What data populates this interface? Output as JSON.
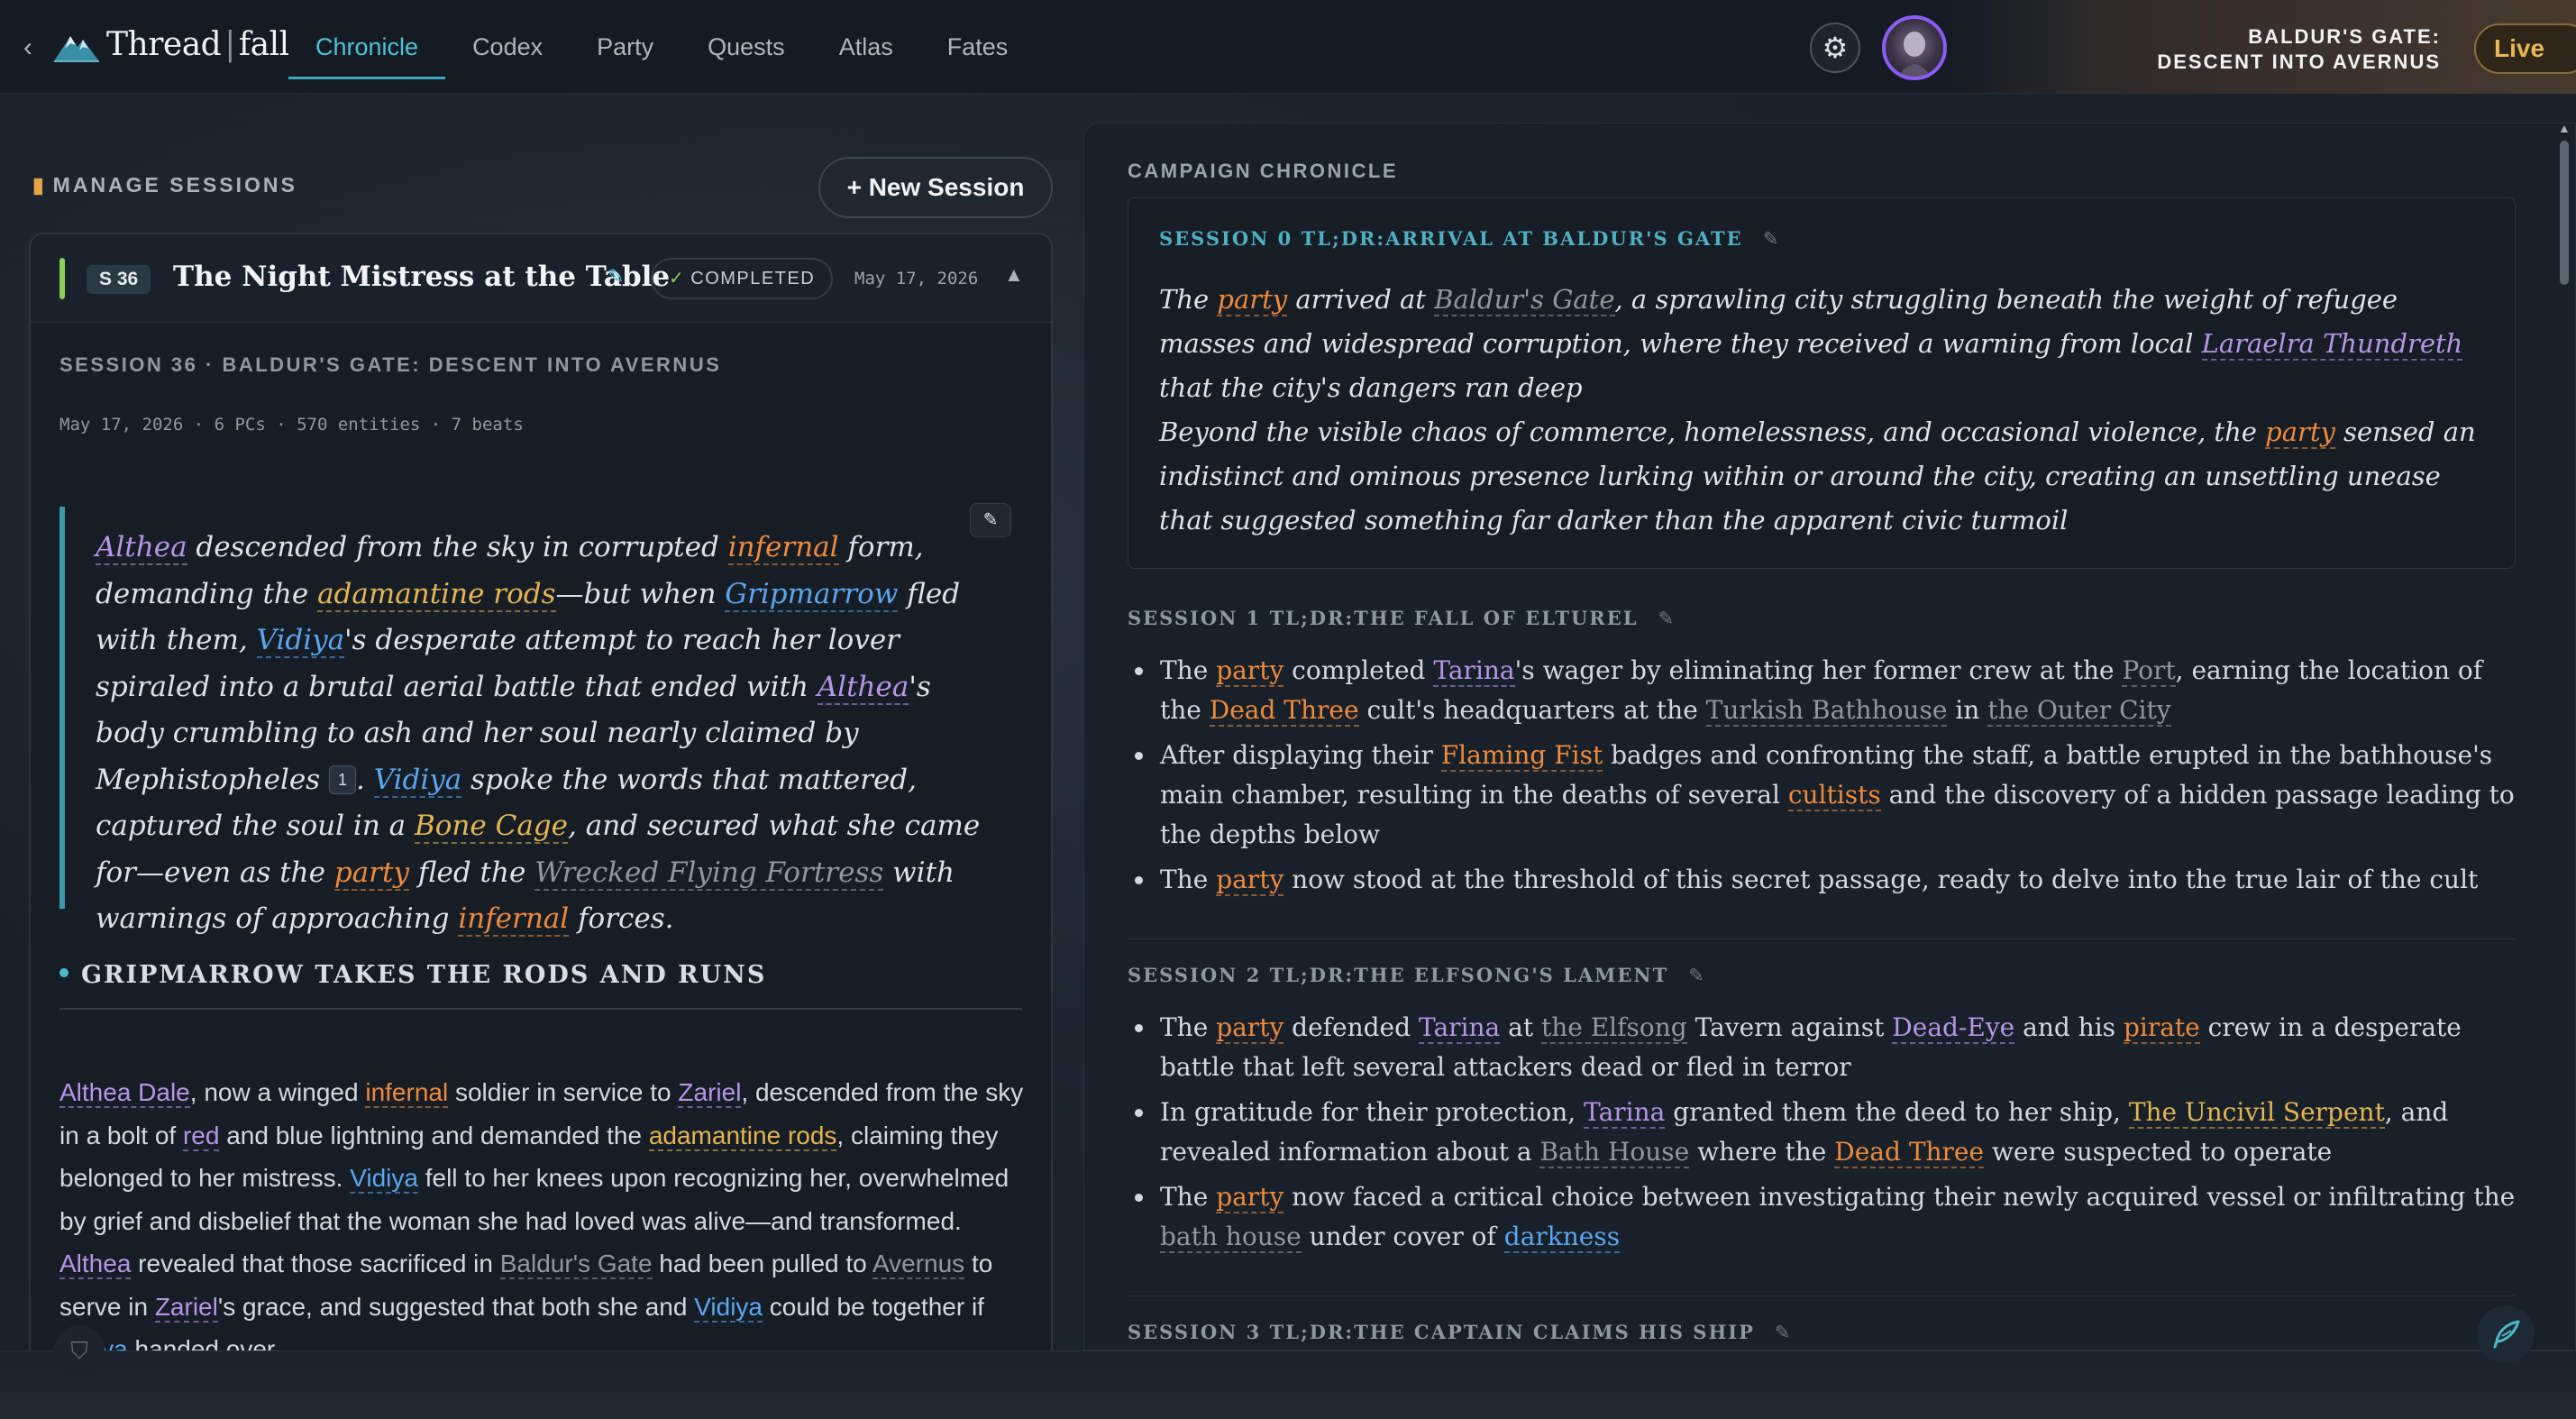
{
  "nav": {
    "back_icon": "chevron-left-icon",
    "brand_left": "Thread",
    "brand_sep": "|",
    "brand_right": "fall",
    "tabs": [
      {
        "label": "Chronicle",
        "active": true
      },
      {
        "label": "Codex"
      },
      {
        "label": "Party"
      },
      {
        "label": "Quests"
      },
      {
        "label": "Atlas"
      },
      {
        "label": "Fates"
      }
    ],
    "settings_icon": "gear-icon",
    "campaign_line1": "BALDUR'S GATE:",
    "campaign_line2": "DESCENT INTO AVERNUS",
    "live_label": "Live"
  },
  "sessions": {
    "manage_label": "MANAGE SESSIONS",
    "new_session_label": "+ New Session",
    "card": {
      "badge": "S 36",
      "title": "The Night Mistress at the Table",
      "status": "COMPLETED",
      "date": "May 17, 2026",
      "subtitle": "SESSION 36 · BALDUR'S GATE: DESCENT INTO AVERNUS",
      "meta": "May 17, 2026 · 6 PCs · 570 entities · 7 beats",
      "citation": "1",
      "beat_title": "GRIPMARROW TAKES THE RODS AND RUNS"
    }
  },
  "chronicle": {
    "label": "CAMPAIGN CHRONICLE",
    "sessions": [
      {
        "tag": "SESSION 0 TL;DR:ARRIVAL AT BALDUR'S GATE"
      },
      {
        "tag": "SESSION 1 TL;DR:THE FALL OF ELTUREL"
      },
      {
        "tag": "SESSION 2 TL;DR:THE ELFSONG'S LAMENT"
      },
      {
        "tag": "SESSION 3 TL;DR:THE CAPTAIN CLAIMS HIS SHIP"
      }
    ]
  },
  "colors": {
    "accent": "#4fc3d6",
    "completed": "#8fcb5a",
    "live": "#e8b656",
    "entity_character": "#b795e8",
    "entity_faction": "#f08a3c",
    "entity_item": "#e5b552",
    "entity_player": "#5aa6f0",
    "entity_place": "#8f98a3"
  }
}
